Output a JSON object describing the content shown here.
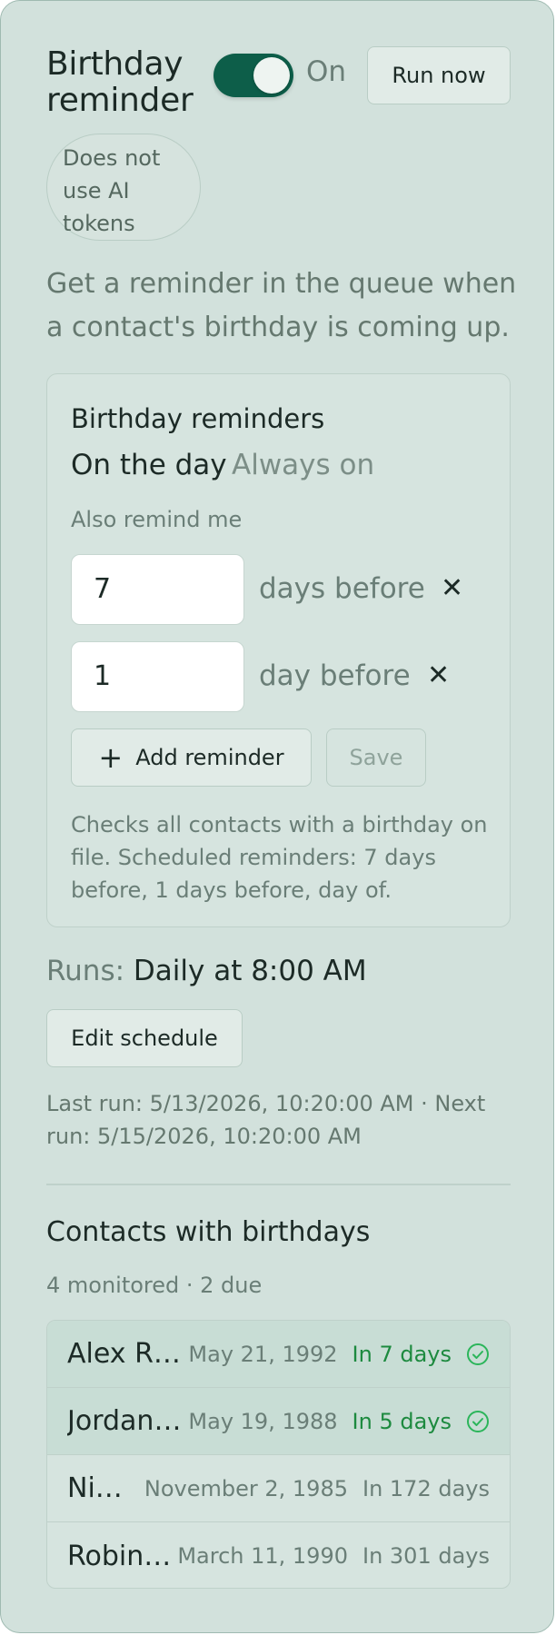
{
  "header": {
    "title": "Birthday reminder",
    "toggle_state": "On",
    "run_now_label": "Run now",
    "token_badge": "Does not use AI tokens"
  },
  "description": "Get a reminder in the queue when a contact's birthday is coming up.",
  "reminders_card": {
    "title": "Birthday reminders",
    "on_the_day_label": "On the day",
    "on_the_day_status": "Always on",
    "also_remind_label": "Also remind me",
    "reminders": [
      {
        "value": "7",
        "unit": "days before"
      },
      {
        "value": "1",
        "unit": "day before"
      }
    ],
    "add_reminder_label": "Add reminder",
    "save_label": "Save",
    "note": "Checks all contacts with a birthday on file. Scheduled reminders: 7 days before, 1 days before, day of."
  },
  "schedule": {
    "runs_label": "Runs:",
    "runs_value": "Daily at 8:00 AM",
    "edit_label": "Edit schedule",
    "last_next_run": "Last run: 5/13/2026, 10:20:00 AM · Next run: 5/15/2026, 10:20:00 AM"
  },
  "contacts": {
    "title": "Contacts with birthdays",
    "summary": "4 monitored · 2 due",
    "rows": [
      {
        "name": "Alex Ri…",
        "date": "May 21, 1992",
        "in": "In 7 days",
        "due": true
      },
      {
        "name": "Jordan …",
        "date": "May 19, 1988",
        "in": "In 5 days",
        "due": true
      },
      {
        "name": "Nin…",
        "date": "November 2, 1985",
        "in": "In 172 days",
        "due": false
      },
      {
        "name": "Robin …",
        "date": "March 11, 1990",
        "in": "In 301 days",
        "due": false
      }
    ]
  },
  "colors": {
    "accent": "#0d5e49",
    "due_green": "#1d8a3f",
    "panel_bg": "#d2e1dc"
  },
  "icons": {
    "close": "close-icon",
    "add": "plus-icon",
    "due": "check-circle-icon"
  }
}
